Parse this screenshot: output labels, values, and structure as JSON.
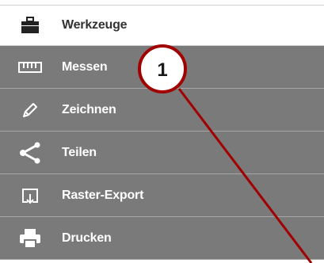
{
  "menu": {
    "header": {
      "label": "Werkzeuge",
      "icon": "toolbox-icon"
    },
    "items": [
      {
        "label": "Messen",
        "icon": "ruler-icon"
      },
      {
        "label": "Zeichnen",
        "icon": "pencil-icon"
      },
      {
        "label": "Teilen",
        "icon": "share-icon"
      },
      {
        "label": "Raster-Export",
        "icon": "raster-export-icon"
      },
      {
        "label": "Drucken",
        "icon": "printer-icon"
      }
    ]
  },
  "callout": {
    "number": "1"
  },
  "colors": {
    "menu_bg": "#7a7a7a",
    "callout_line": "#a00000",
    "callout_border": "#a00000"
  }
}
